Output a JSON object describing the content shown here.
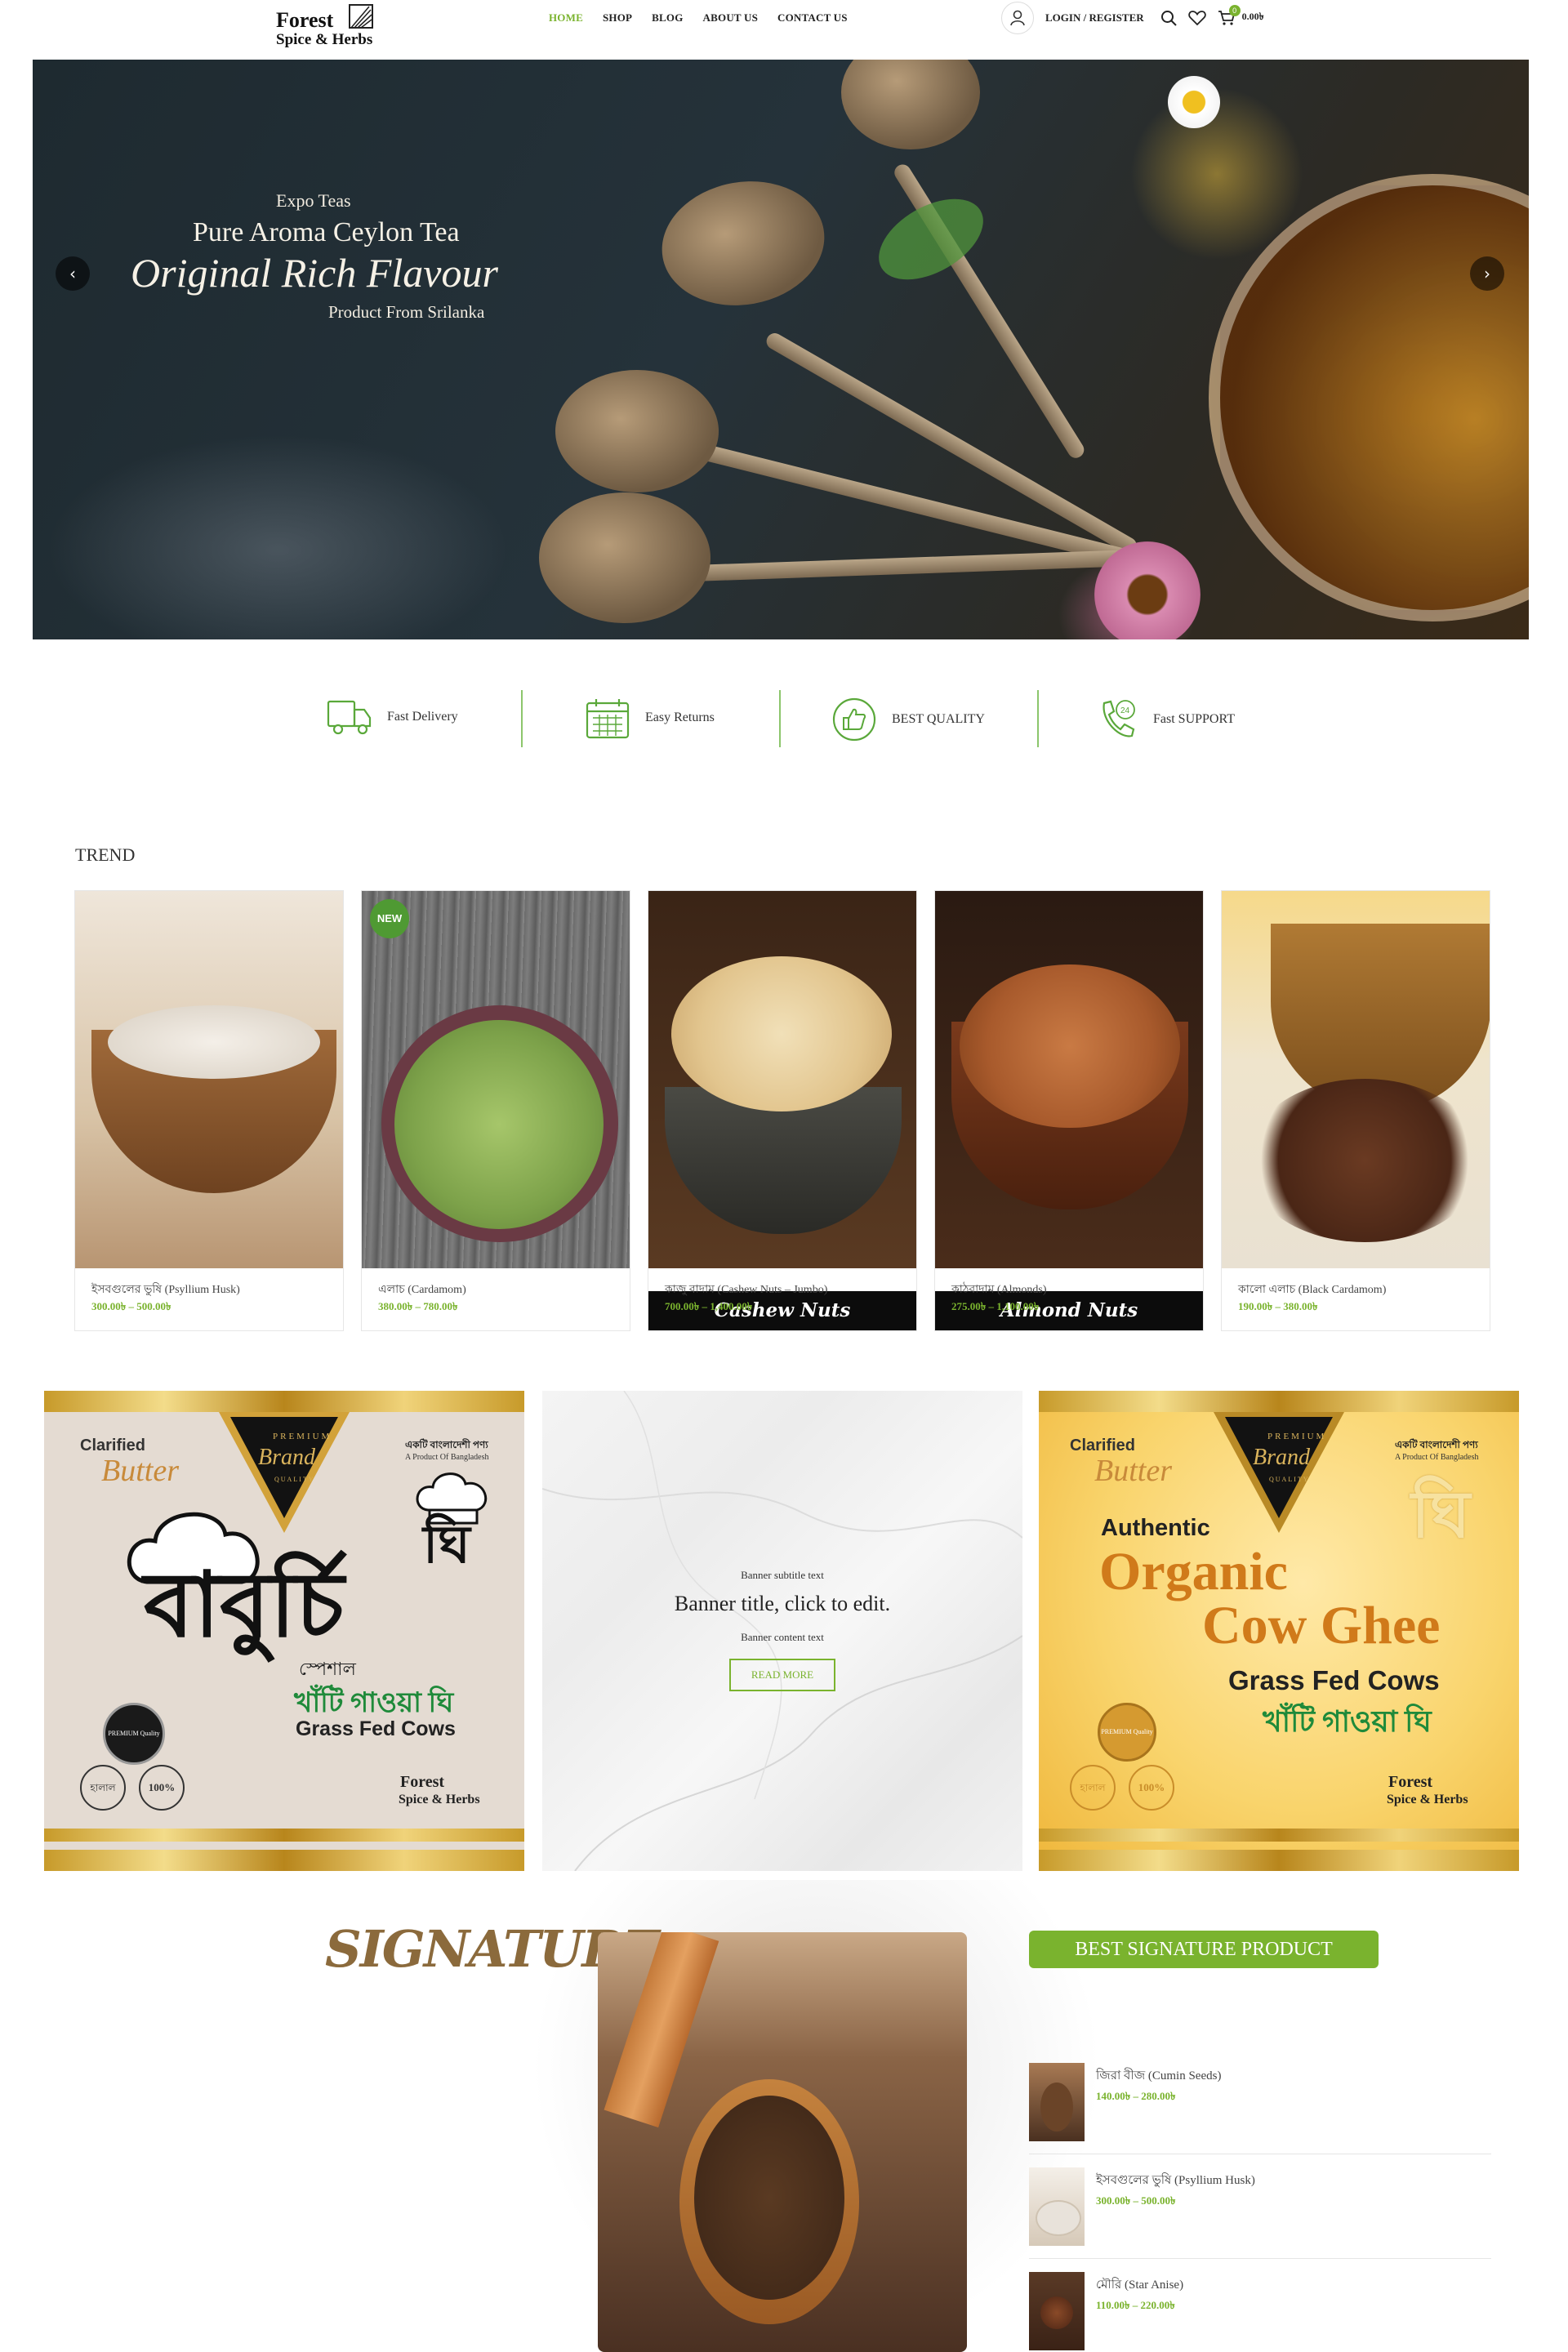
{
  "header": {
    "logo_line1": "Forest",
    "logo_line2": "Spice & Herbs",
    "nav": [
      "HOME",
      "SHOP",
      "BLOG",
      "ABOUT US",
      "CONTACT US"
    ],
    "login_label": "LOGIN / REGISTER",
    "cart_count": "0",
    "cart_total": "0.00৳"
  },
  "hero": {
    "line1": "Expo Teas",
    "line2": "Pure Aroma Ceylon Tea",
    "line3": "Original Rich Flavour",
    "line4": "Product From Srilanka"
  },
  "features": [
    {
      "label": "Fast Delivery",
      "icon": "truck-icon"
    },
    {
      "label": "Easy Returns",
      "icon": "calendar-icon"
    },
    {
      "label": "BEST QUALITY",
      "icon": "thumbs-up-icon"
    },
    {
      "label": "Fast SUPPORT",
      "icon": "phone-24-icon"
    }
  ],
  "trend": {
    "title": "TREND",
    "products": [
      {
        "name": "ইসবগুলের ভুষি (Psyllium Husk)",
        "price": "300.00৳ – 500.00৳",
        "badge": "",
        "overlay": ""
      },
      {
        "name": "এলাচ (Cardamom)",
        "price": "380.00৳ – 780.00৳",
        "badge": "NEW",
        "overlay": ""
      },
      {
        "name": "কাজু বাদাম (Cashew Nuts – Jumbo)",
        "price": "700.00৳ – 1,400.00৳",
        "badge": "",
        "overlay": "Cashew Nuts"
      },
      {
        "name": "কাঠবাদাম (Almonds)",
        "price": "275.00৳ – 1,100.00৳",
        "badge": "",
        "overlay": "Almond Nuts"
      },
      {
        "name": "কালো এলাচ (Black Cardamom)",
        "price": "190.00৳ – 380.00৳",
        "badge": "",
        "overlay": ""
      }
    ]
  },
  "banners": {
    "left": {
      "clarified": "Clarified",
      "butter": "Butter",
      "premium": "PREMIUM",
      "brand": "Brand",
      "quality": "QUALITY",
      "bd_product": "একটি বাংলাদেশী পণ্য",
      "bd_product_en": "A Product Of Bangladesh",
      "ghee_bn": "ঘি",
      "big_bn": "বাবুর্চি",
      "special_bn": "স্পেশাল",
      "khati_bn": "খাঁটি গাওয়া ঘি",
      "grass": "Grass Fed Cows",
      "logo1": "Forest",
      "logo2": "Spice & Herbs",
      "seal": "PREMIUM Quality",
      "halal": "হালাল",
      "natural": "100%"
    },
    "middle": {
      "subtitle": "Banner subtitle text",
      "title": "Banner title, click to edit.",
      "content": "Banner content text",
      "button": "READ MORE"
    },
    "right": {
      "clarified": "Clarified",
      "butter": "Butter",
      "premium": "PREMIUM",
      "brand": "Brand",
      "quality": "QUALITY",
      "bd_product": "একটি বাংলাদেশী পণ্য",
      "bd_product_en": "A Product Of Bangladesh",
      "ghee_bn": "ঘি",
      "authentic": "Authentic",
      "organic": "Organic",
      "cowghee": "Cow Ghee",
      "grass": "Grass Fed Cows",
      "khati_bn": "খাঁটি গাওয়া ঘি",
      "logo1": "Forest",
      "logo2": "Spice & Herbs",
      "seal": "PREMIUM Quality",
      "halal": "হালাল",
      "natural": "100%"
    }
  },
  "signature": {
    "title": "SIGNATURE",
    "best_label": "BEST SIGNATURE PRODUCT",
    "items": [
      {
        "name": "জিরা বীজ (Cumin Seeds)",
        "price": "140.00৳ – 280.00৳"
      },
      {
        "name": "ইসবগুলের ভুষি (Psyllium Husk)",
        "price": "300.00৳ – 500.00৳"
      },
      {
        "name": "মৌরি (Star Anise)",
        "price": "110.00৳ – 220.00৳"
      }
    ]
  },
  "colors": {
    "accent": "#7ab32e",
    "badge_new": "#4f9a33",
    "signature_brown": "#8b6a3c"
  }
}
